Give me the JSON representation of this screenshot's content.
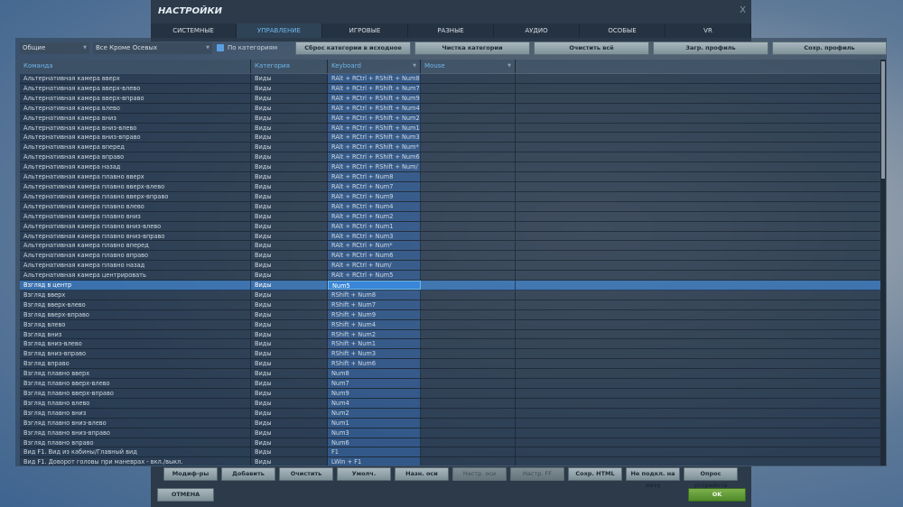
{
  "window": {
    "title": "НАСТРОЙКИ",
    "close": "X"
  },
  "tabs": [
    "СИСТЕМНЫЕ",
    "УПРАВЛЕНИЕ",
    "ИГРОВЫЕ",
    "РАЗНЫЕ",
    "АУДИО",
    "ОСОБЫЕ",
    "VR"
  ],
  "active_tab": "УПРАВЛЕНИЕ",
  "toolbar": {
    "aircraft": "Общие",
    "filter": "Все Кроме Осевых",
    "by_category": "По категориям",
    "reset_category": "Сброс категории в исходное",
    "clear_category": "Чистка категории",
    "clear_all": "Очистить всё",
    "load_profile": "Загр. профиль",
    "save_profile": "Сохр. профиль"
  },
  "columns": {
    "command": "Команда",
    "category": "Категория",
    "keyboard": "Keyboard",
    "mouse": "Mouse"
  },
  "rows": [
    [
      "Альтернативная камера вверх",
      "Виды",
      "RAlt + RCtrl + RShift + Num8"
    ],
    [
      "Альтернативная камера вверх-влево",
      "Виды",
      "RAlt + RCtrl + RShift + Num7"
    ],
    [
      "Альтернативная камера вверх-вправо",
      "Виды",
      "RAlt + RCtrl + RShift + Num9"
    ],
    [
      "Альтернативная камера влево",
      "Виды",
      "RAlt + RCtrl + RShift + Num4"
    ],
    [
      "Альтернативная камера вниз",
      "Виды",
      "RAlt + RCtrl + RShift + Num2"
    ],
    [
      "Альтернативная камера вниз-влево",
      "Виды",
      "RAlt + RCtrl + RShift + Num1"
    ],
    [
      "Альтернативная камера вниз-вправо",
      "Виды",
      "RAlt + RCtrl + RShift + Num3"
    ],
    [
      "Альтернативная камера вперед",
      "Виды",
      "RAlt + RCtrl + RShift + Num*"
    ],
    [
      "Альтернативная камера вправо",
      "Виды",
      "RAlt + RCtrl + RShift + Num6"
    ],
    [
      "Альтернативная камера назад",
      "Виды",
      "RAlt + RCtrl + RShift + Num/"
    ],
    [
      "Альтернативная камера плавно вверх",
      "Виды",
      "RAlt + RCtrl + Num8"
    ],
    [
      "Альтернативная камера плавно вверх-влево",
      "Виды",
      "RAlt + RCtrl + Num7"
    ],
    [
      "Альтернативная камера плавно вверх-вправо",
      "Виды",
      "RAlt + RCtrl + Num9"
    ],
    [
      "Альтернативная камера плавно влево",
      "Виды",
      "RAlt + RCtrl + Num4"
    ],
    [
      "Альтернативная камера плавно вниз",
      "Виды",
      "RAlt + RCtrl + Num2"
    ],
    [
      "Альтернативная камера плавно вниз-влево",
      "Виды",
      "RAlt + RCtrl + Num1"
    ],
    [
      "Альтернативная камера плавно вниз-вправо",
      "Виды",
      "RAlt + RCtrl + Num3"
    ],
    [
      "Альтернативная камера плавно вперед",
      "Виды",
      "RAlt + RCtrl + Num*"
    ],
    [
      "Альтернативная камера плавно вправо",
      "Виды",
      "RAlt + RCtrl + Num6"
    ],
    [
      "Альтернативная камера плавно назад",
      "Виды",
      "RAlt + RCtrl + Num/"
    ],
    [
      "Альтернативная камера центрировать",
      "Виды",
      "RAlt + RCtrl + Num5"
    ],
    [
      "Взгляд в центр",
      "Виды",
      "Num5"
    ],
    [
      "Взгляд вверх",
      "Виды",
      "RShift + Num8"
    ],
    [
      "Взгляд вверх-влево",
      "Виды",
      "RShift + Num7"
    ],
    [
      "Взгляд вверх-вправо",
      "Виды",
      "RShift + Num9"
    ],
    [
      "Взгляд влево",
      "Виды",
      "RShift + Num4"
    ],
    [
      "Взгляд вниз",
      "Виды",
      "RShift + Num2"
    ],
    [
      "Взгляд вниз-влево",
      "Виды",
      "RShift + Num1"
    ],
    [
      "Взгляд вниз-вправо",
      "Виды",
      "RShift + Num3"
    ],
    [
      "Взгляд вправо",
      "Виды",
      "RShift + Num6"
    ],
    [
      "Взгляд плавно вверх",
      "Виды",
      "Num8"
    ],
    [
      "Взгляд плавно вверх-влево",
      "Виды",
      "Num7"
    ],
    [
      "Взгляд плавно вверх-вправо",
      "Виды",
      "Num9"
    ],
    [
      "Взгляд плавно влево",
      "Виды",
      "Num4"
    ],
    [
      "Взгляд плавно вниз",
      "Виды",
      "Num2"
    ],
    [
      "Взгляд плавно вниз-влево",
      "Виды",
      "Num1"
    ],
    [
      "Взгляд плавно вниз-вправо",
      "Виды",
      "Num3"
    ],
    [
      "Взгляд плавно вправо",
      "Виды",
      "Num6"
    ],
    [
      "Вид F1. Вид из кабины/Главный вид",
      "Виды",
      "F1"
    ],
    [
      "Вид F1. Доворот головы при маневрах - вкл./выкл.",
      "Виды",
      "LWin + F1"
    ]
  ],
  "selected_row": 21,
  "bottom_buttons": [
    {
      "label": "Модиф-ры",
      "enabled": true
    },
    {
      "label": "Добавить",
      "enabled": true
    },
    {
      "label": "Очистить",
      "enabled": true
    },
    {
      "label": "Умолч.",
      "enabled": true
    },
    {
      "label": "Назн. оси",
      "enabled": true
    },
    {
      "label": "Настр. оси",
      "enabled": false
    },
    {
      "label": "Настр. FF",
      "enabled": false
    },
    {
      "label": "Сохр. HTML",
      "enabled": true
    },
    {
      "label": "Не подкл. на лету",
      "enabled": true
    },
    {
      "label": "Опрос устройств",
      "enabled": true
    }
  ],
  "cancel": "ОТМЕНА",
  "ok": "OK"
}
